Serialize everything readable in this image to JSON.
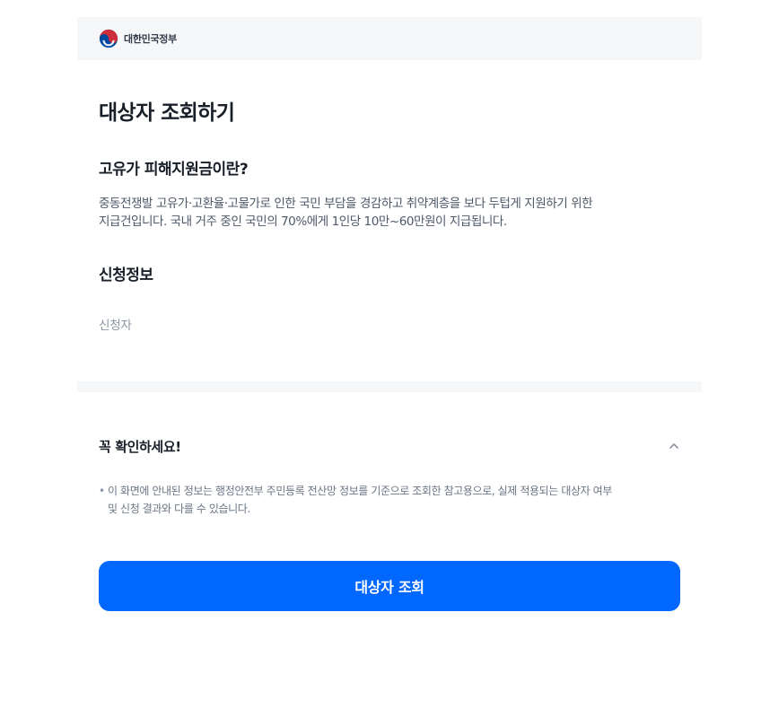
{
  "header": {
    "org_name": "대한민국정부",
    "logo_icon": "taegeuk-icon"
  },
  "page": {
    "title": "대상자 조회하기"
  },
  "about": {
    "title": "고유가 피해지원금이란?",
    "line1": "중동전쟁발 고유가·고환율·고물가로 인한 국민 부담을 경감하고 취약계층을 보다 두텁게 지원하기 위한",
    "line2": "지급건입니다. 국내 거주 중인 국민의 70%에게 1인당 10만~60만원이 지급됩니다."
  },
  "application": {
    "title": "신청정보",
    "applicant_label": "신청자"
  },
  "notice": {
    "title": "꼭 확인하세요!",
    "toggle_icon": "chevron-up-icon",
    "items": [
      {
        "line1": "이 화면에 안내된 정보는 행정안전부 주민등록 전산망 정보를 기준으로 조회한 참고용으로, 실제 적용되는 대상자 여부",
        "line2": "및 신청 결과와 다를 수 있습니다."
      }
    ]
  },
  "actions": {
    "lookup_label": "대상자 조회"
  },
  "colors": {
    "primary": "#0067ff",
    "header_bg": "#f6f7f9",
    "text_main": "#191f28",
    "text_sub": "#4e5968",
    "text_muted": "#8b95a1"
  }
}
